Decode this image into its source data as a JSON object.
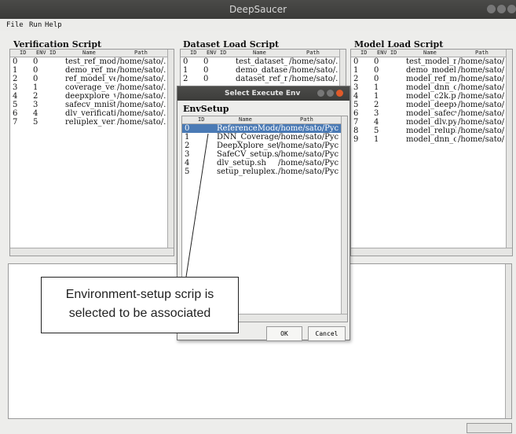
{
  "window": {
    "title": "DeepSaucer"
  },
  "menu": [
    "File",
    "Run",
    "Help"
  ],
  "verification": {
    "title": "Verification Script",
    "columns": [
      "ID",
      "ENV ID",
      "Name",
      "Path"
    ],
    "rows": [
      [
        "0",
        "0",
        "test_ref_modé",
        "/home/sato/."
      ],
      [
        "1",
        "0",
        "demo_ref_mé",
        "/home/sato/."
      ],
      [
        "2",
        "0",
        "ref_model_ve",
        "/home/sato/."
      ],
      [
        "3",
        "1",
        "coverage_ver",
        "/home/sato/."
      ],
      [
        "4",
        "2",
        "deepxplore_v",
        "/home/sato/."
      ],
      [
        "5",
        "3",
        "safecv_mnist.",
        "/home/sato/."
      ],
      [
        "6",
        "4",
        "dlv_verificati",
        "/home/sato/."
      ],
      [
        "7",
        "5",
        "reluplex_veri",
        "/home/sato/."
      ]
    ]
  },
  "dataset": {
    "title": "Dataset Load Script",
    "columns": [
      "ID",
      "ENV ID",
      "Name",
      "Path"
    ],
    "rows": [
      [
        "0",
        "0",
        "test_dataset_r",
        "/home/sato/."
      ],
      [
        "1",
        "0",
        "demo_datase",
        "/home/sato/."
      ],
      [
        "2",
        "0",
        "dataset_ref_r",
        "/home/sato/."
      ]
    ]
  },
  "model": {
    "title": "Model Load Script",
    "columns": [
      "ID",
      "ENV ID",
      "Name",
      "Path"
    ],
    "rows": [
      [
        "0",
        "0",
        "test_model_r",
        "/home/sato/."
      ],
      [
        "1",
        "0",
        "demo_model",
        "/home/sato/."
      ],
      [
        "2",
        "0",
        "model_ref_m",
        "/home/sato/."
      ],
      [
        "3",
        "1",
        "model_dnn_c",
        "/home/sato/."
      ],
      [
        "4",
        "1",
        "model_c2k.py",
        "/home/sato/."
      ],
      [
        "5",
        "2",
        "model_deepx",
        "/home/sato/."
      ],
      [
        "6",
        "3",
        "model_safecv",
        "/home/sato/."
      ],
      [
        "7",
        "4",
        "model_dlv.py",
        "/home/sato/."
      ],
      [
        "8",
        "5",
        "model_relupl",
        "/home/sato/."
      ],
      [
        "9",
        "1",
        "model_dnn_c",
        "/home/sato/."
      ]
    ]
  },
  "dialog": {
    "title": "Select Execute Env",
    "label": "EnvSetup",
    "columns": [
      "ID",
      "Name",
      "Path"
    ],
    "rows": [
      [
        "0",
        "ReferenceModel",
        "/home/sato/Pyc"
      ],
      [
        "1",
        "DNN_Coverage_",
        "/home/sato/Pyc"
      ],
      [
        "2",
        "DeepXplore_setu",
        "/home/sato/Pyc"
      ],
      [
        "3",
        "SafeCV_setup.sh",
        "/home/sato/Pyc"
      ],
      [
        "4",
        "dlv_setup.sh",
        "/home/sato/Pyc"
      ],
      [
        "5",
        "setup_reluplex.s",
        "/home/sato/Pyc"
      ]
    ],
    "selected_index": 0,
    "ok_label": "OK",
    "cancel_label": "Cancel"
  },
  "callout": {
    "line1": "Environment-setup scrip is",
    "line2": "selected to be associated"
  },
  "colors": {
    "selection": "#4a7ab5",
    "titlebar": "#3c3c3a",
    "close_button": "#e05a2a"
  }
}
